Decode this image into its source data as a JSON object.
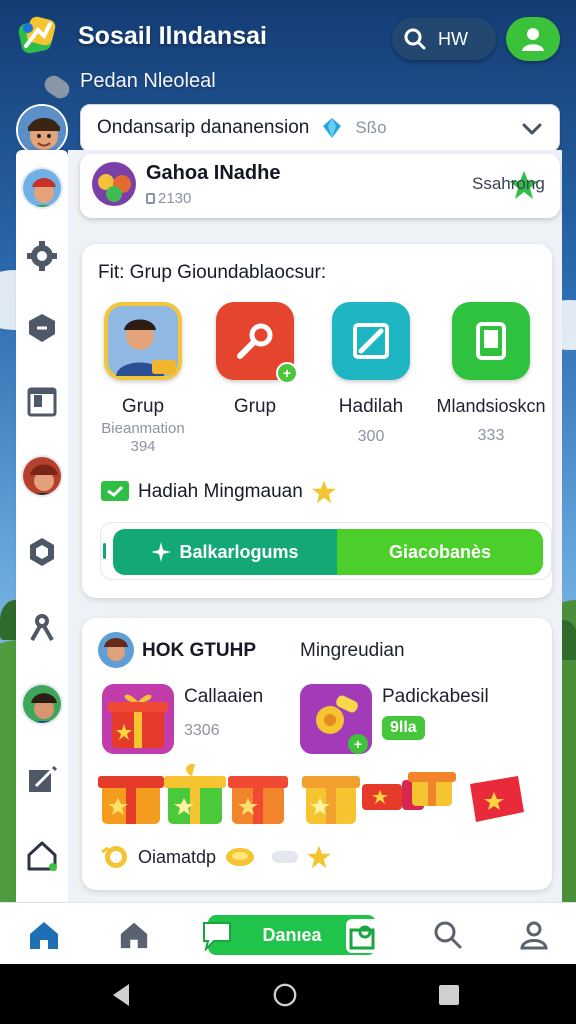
{
  "header": {
    "app_title": "Sosail Ilndansai",
    "subtitle": "Pedan Nleoleal",
    "search_label": "HW"
  },
  "dropdown": {
    "text": "Ondansarip dananension",
    "count": "Sßo"
  },
  "group_card": {
    "name": "Gahoa INadhe",
    "count": "2130",
    "status": "Ssahrong"
  },
  "featured": {
    "title": "Fit: Grup Gioundablaocsur:",
    "tiles": [
      {
        "label": "Grup",
        "sub1": "Bieanmation",
        "sub2": "394",
        "count": ""
      },
      {
        "label": "Grup",
        "sub1": "",
        "sub2": "",
        "count": ""
      },
      {
        "label": "Hadilah",
        "sub1": "",
        "sub2": "",
        "count": "300"
      },
      {
        "label": "Mlandsioskcn",
        "sub1": "",
        "sub2": "",
        "count": "333"
      }
    ],
    "hadiah_text": "Hadiah Mingmauan",
    "seg_left": "Balkarlogums",
    "seg_right": "Giacobanès"
  },
  "card2": {
    "title": "HOK GTUHP",
    "right_title": "Mingreudian",
    "reward1": {
      "title": "Callaaien",
      "count": "3306"
    },
    "reward2": {
      "title": "Padickabesil",
      "badge": "9lla"
    },
    "diamond_text": "Oiamatdp"
  },
  "bottom_nav": {
    "center_label": "Danıea"
  },
  "colors": {
    "primary_green": "#20c44a",
    "teal": "#13a876",
    "lime": "#4ccf2a",
    "nav_blue": "#1f6fb5"
  }
}
